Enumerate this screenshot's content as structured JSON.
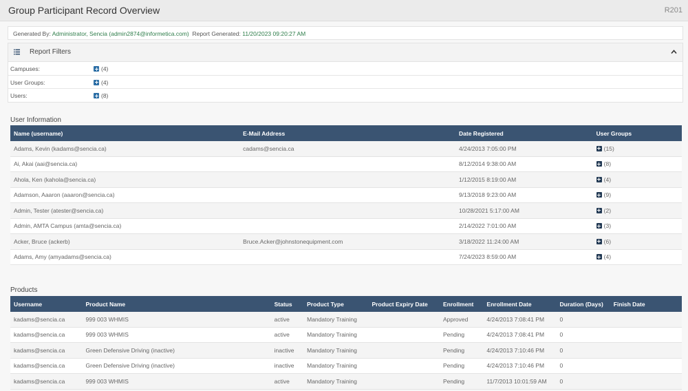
{
  "header": {
    "title": "Group Participant Record Overview",
    "code": "R201"
  },
  "generated": {
    "by_label": "Generated By:",
    "by_value": "Administrator, Sencia (admin2874@informetica.com)",
    "report_label": "Report Generated:",
    "report_value": "11/20/2023 09:20:27 AM"
  },
  "filters": {
    "title": "Report Filters",
    "rows": [
      {
        "label": "Campuses:",
        "count": "(4)"
      },
      {
        "label": "User Groups:",
        "count": "(4)"
      },
      {
        "label": "Users:",
        "count": "(8)"
      }
    ]
  },
  "user_info": {
    "title": "User Information",
    "columns": [
      "Name (username)",
      "E-Mail Address",
      "Date Registered",
      "User Groups"
    ],
    "rows": [
      {
        "name": "Adams, Kevin (kadams@sencia.ca)",
        "email": "cadams@sencia.ca",
        "date": "4/24/2013 7:05:00 PM",
        "groups": "(15)"
      },
      {
        "name": "Ai, Akai (aai@sencia.ca)",
        "email": "",
        "date": "8/12/2014 9:38:00 AM",
        "groups": "(8)"
      },
      {
        "name": "Ahola, Ken (kahola@sencia.ca)",
        "email": "",
        "date": "1/12/2015 8:19:00 AM",
        "groups": "(4)"
      },
      {
        "name": "Adamson, Aaaron (aaaron@sencia.ca)",
        "email": "",
        "date": "9/13/2018 9:23:00 AM",
        "groups": "(9)"
      },
      {
        "name": "Admin, Tester (atester@sencia.ca)",
        "email": "",
        "date": "10/28/2021 5:17:00 AM",
        "groups": "(2)"
      },
      {
        "name": "Admin, AMTA Campus (amta@sencia.ca)",
        "email": "",
        "date": "2/14/2022 7:01:00 AM",
        "groups": "(3)"
      },
      {
        "name": "Acker, Bruce (ackerb)",
        "email": "Bruce.Acker@johnstonequipment.com",
        "date": "3/18/2022 11:24:00 AM",
        "groups": "(6)"
      },
      {
        "name": "Adams, Amy (amyadams@sencia.ca)",
        "email": "",
        "date": "7/24/2023 8:59:00 AM",
        "groups": "(4)"
      }
    ]
  },
  "products": {
    "title": "Products",
    "columns": [
      "Username",
      "Product Name",
      "Status",
      "Product Type",
      "Product Expiry Date",
      "Enrollment",
      "Enrollment Date",
      "Duration (Days)",
      "Finish Date"
    ],
    "rows": [
      {
        "username": "kadams@sencia.ca",
        "product": "999 003 WHMIS",
        "status": "active",
        "type": "Mandatory Training",
        "expiry": "",
        "enrollment": "Approved",
        "enroll_date": "4/24/2013 7:08:41 PM",
        "duration": "0",
        "finish": ""
      },
      {
        "username": "kadams@sencia.ca",
        "product": "999 003 WHMIS",
        "status": "active",
        "type": "Mandatory Training",
        "expiry": "",
        "enrollment": "Pending",
        "enroll_date": "4/24/2013 7:08:41 PM",
        "duration": "0",
        "finish": ""
      },
      {
        "username": "kadams@sencia.ca",
        "product": "Green Defensive Driving (inactive)",
        "status": "inactive",
        "type": "Mandatory Training",
        "expiry": "",
        "enrollment": "Pending",
        "enroll_date": "4/24/2013 7:10:46 PM",
        "duration": "0",
        "finish": ""
      },
      {
        "username": "kadams@sencia.ca",
        "product": "Green Defensive Driving (inactive)",
        "status": "inactive",
        "type": "Mandatory Training",
        "expiry": "",
        "enrollment": "Pending",
        "enroll_date": "4/24/2013 7:10:46 PM",
        "duration": "0",
        "finish": ""
      },
      {
        "username": "kadams@sencia.ca",
        "product": "999 003 WHMIS",
        "status": "active",
        "type": "Mandatory Training",
        "expiry": "",
        "enrollment": "Pending",
        "enroll_date": "11/7/2013 10:01:59 AM",
        "duration": "0",
        "finish": ""
      }
    ]
  }
}
